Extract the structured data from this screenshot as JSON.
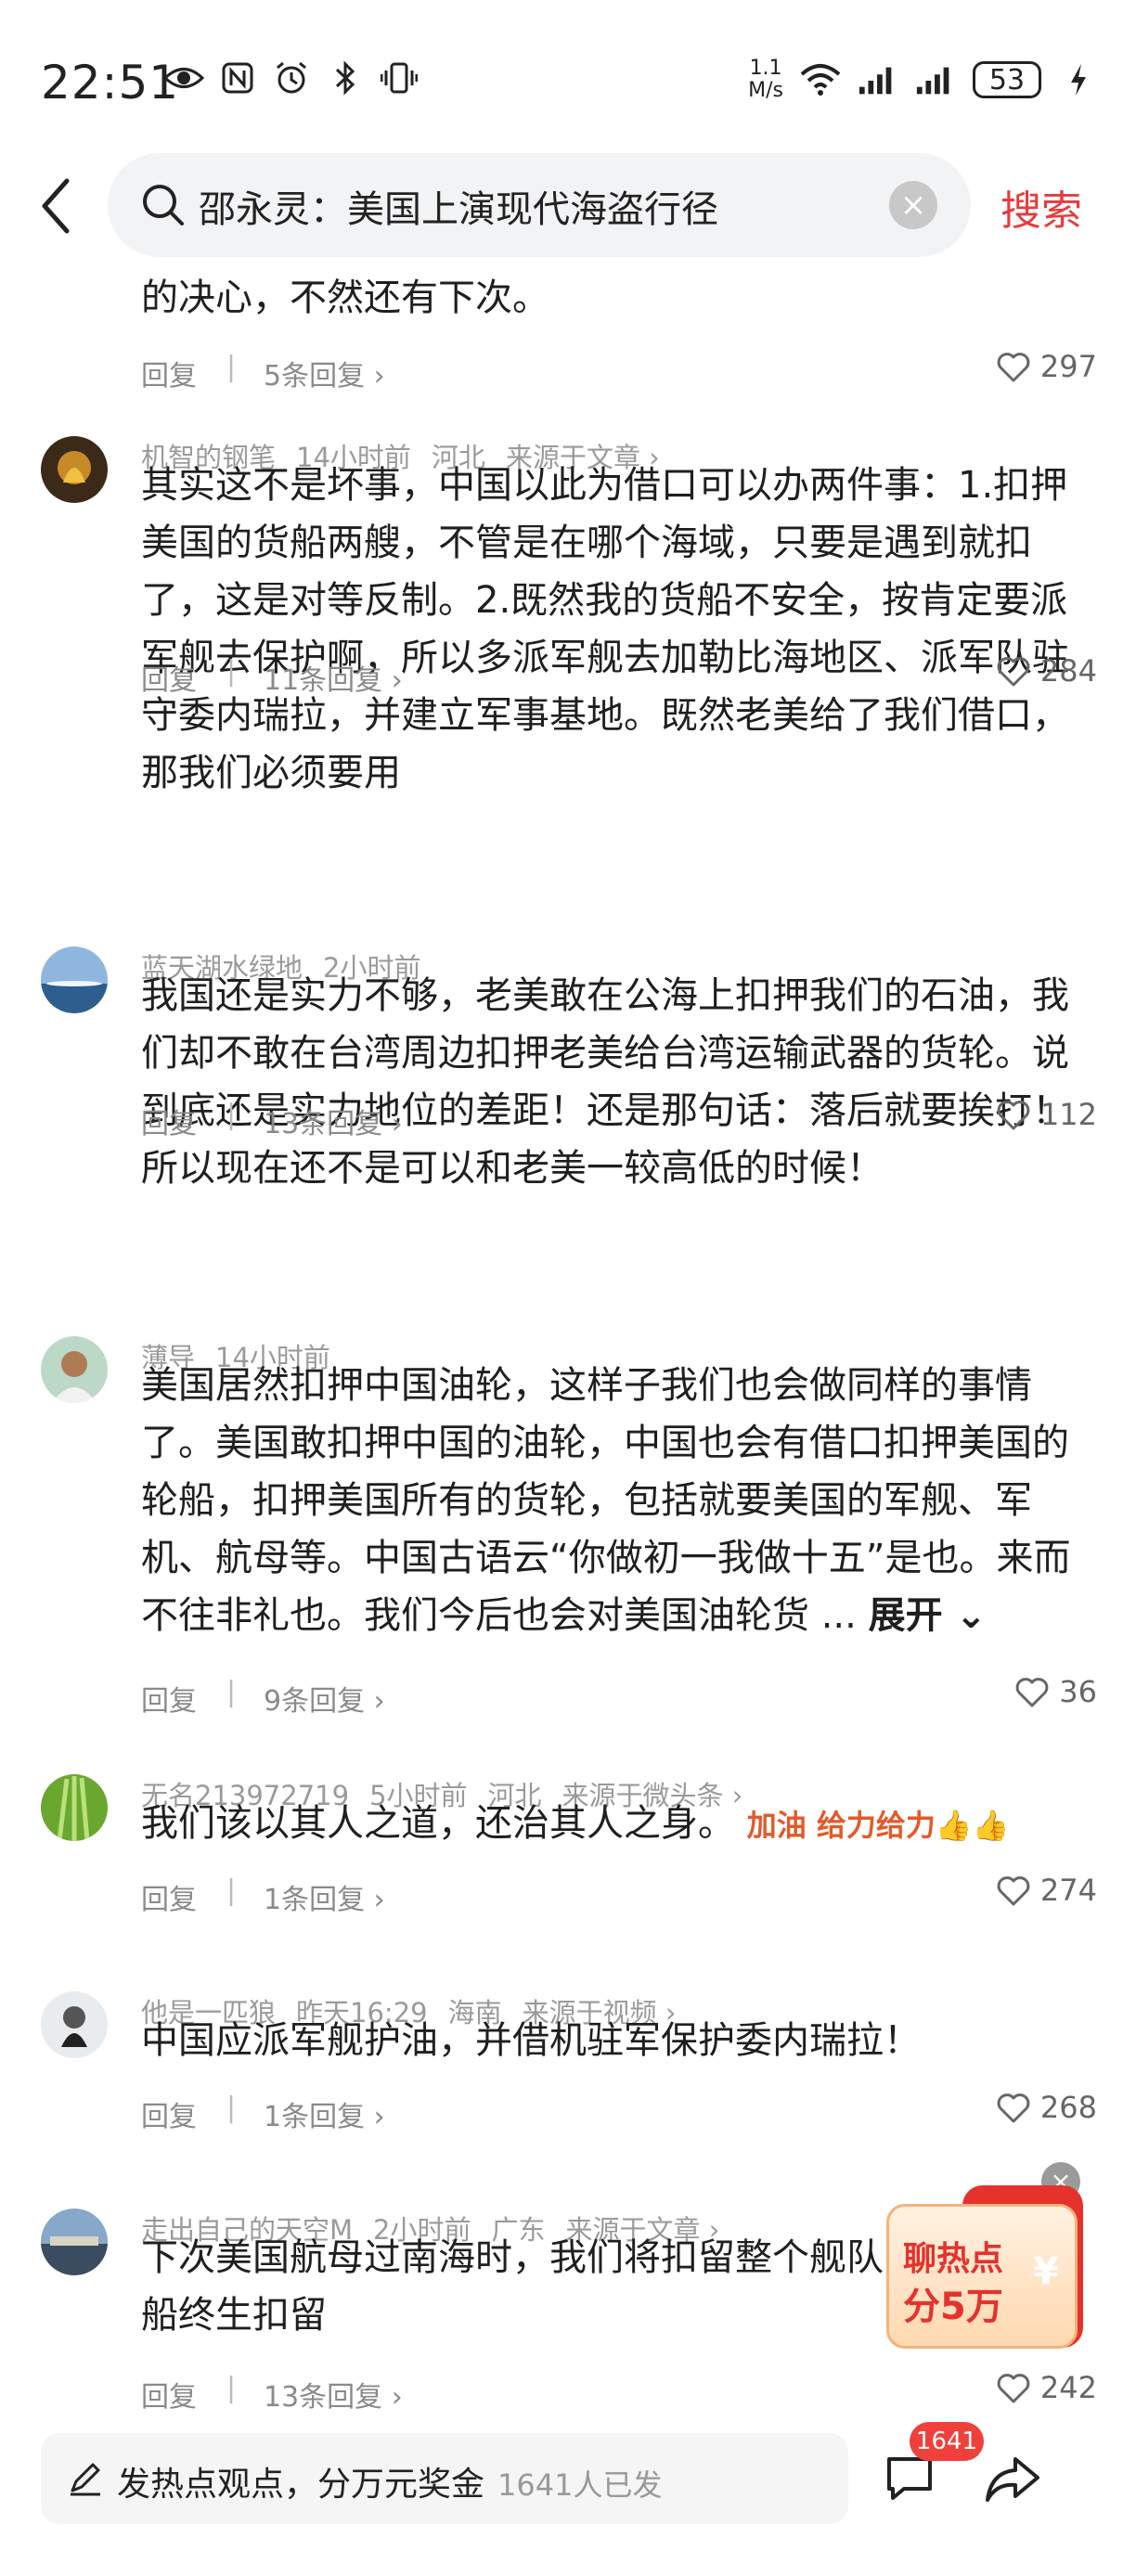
{
  "status_bar": {
    "time": "22:51",
    "net_speed_value": "1.1",
    "net_speed_unit": "M/s",
    "battery": "53",
    "icons": [
      "eye-icon",
      "nfc-icon",
      "alarm-icon",
      "bluetooth-icon",
      "vibrate-icon",
      "wifi-icon",
      "signal-icon",
      "signal-icon",
      "charging-icon"
    ]
  },
  "header": {
    "search_query": "邵永灵：美国上演现代海盗行径",
    "search_button": "搜索"
  },
  "partial_comment": {
    "text": "的决心，不然还有下次。",
    "reply_label": "回复",
    "reply_count": "5条回复 ›",
    "likes": "297"
  },
  "comments": [
    {
      "user": "机智的钢笔",
      "time": "14小时前",
      "location": "河北",
      "source": "来源于文章 ›",
      "text": "其实这不是坏事，中国以此为借口可以办两件事：1.扣押美国的货船两艘，不管是在哪个海域，只要是遇到就扣了，这是对等反制。2.既然我的货船不安全，按肯定要派军舰去保护啊，所以多派军舰去加勒比海地区、派军队驻守委内瑞拉，并建立军事基地。既然老美给了我们借口，那我们必须要用",
      "reply_label": "回复",
      "reply_count": "11条回复 ›",
      "likes": "284"
    },
    {
      "user": "蓝天湖水绿地",
      "time": "2小时前",
      "location": "",
      "source": "",
      "text": "我国还是实力不够，老美敢在公海上扣押我们的石油，我们却不敢在台湾周边扣押老美给台湾运输武器的货轮。说到底还是实力地位的差距！还是那句话：落后就要挨打！所以现在还不是可以和老美一较高低的时候！",
      "reply_label": "回复",
      "reply_count": "13条回复 ›",
      "likes": "112"
    },
    {
      "user": "薄导",
      "time": "14小时前",
      "location": "",
      "source": "",
      "text": "美国居然扣押中国油轮，这样子我们也会做同样的事情了。美国敢扣押中国的油轮，中国也会有借口扣押美国的轮船，扣押美国所有的货轮，包括就要美国的军舰、军机、航母等。中国古语云“你做初一我做十五”是也。来而不往非礼也。我们今后也会对美国油轮货 ...",
      "expand_label": "展开 ⌄",
      "reply_label": "回复",
      "reply_count": "9条回复 ›",
      "likes": "36"
    },
    {
      "user": "无名213972719",
      "time": "5小时前",
      "location": "河北",
      "source": "来源于微头条 ›",
      "text": "我们该以其人之道，还治其人之身。",
      "emoji_text": "加油 给力给力👍👍",
      "reply_label": "回复",
      "reply_count": "1条回复 ›",
      "likes": "274"
    },
    {
      "user": "他是一匹狼",
      "time": "昨天16:29",
      "location": "海南",
      "source": "来源于视频 ›",
      "text": "中国应派军舰护油，并借机驻军保护委内瑞拉！",
      "reply_label": "回复",
      "reply_count": "1条回复 ›",
      "likes": "268"
    },
    {
      "user": "走出自己的天空M",
      "time": "2小时前",
      "location": "广东",
      "source": "来源于文章 ›",
      "text": "下次美国航母过南海时，我们将扣留整个舰队，船终生扣留",
      "reply_label": "回复",
      "reply_count": "13条回复 ›",
      "likes": "242"
    }
  ],
  "promo": {
    "line1": "聊热点",
    "line2": "分5万",
    "symbol": "¥",
    "close": "×"
  },
  "bottom_bar": {
    "input_text": "发热点观点，分万元奖金",
    "input_sub": "1641人已发",
    "comment_badge": "1641"
  },
  "colors": {
    "accent": "#e83b3b",
    "meta_gray": "#9a9a9a",
    "text": "#1f1f1f"
  }
}
